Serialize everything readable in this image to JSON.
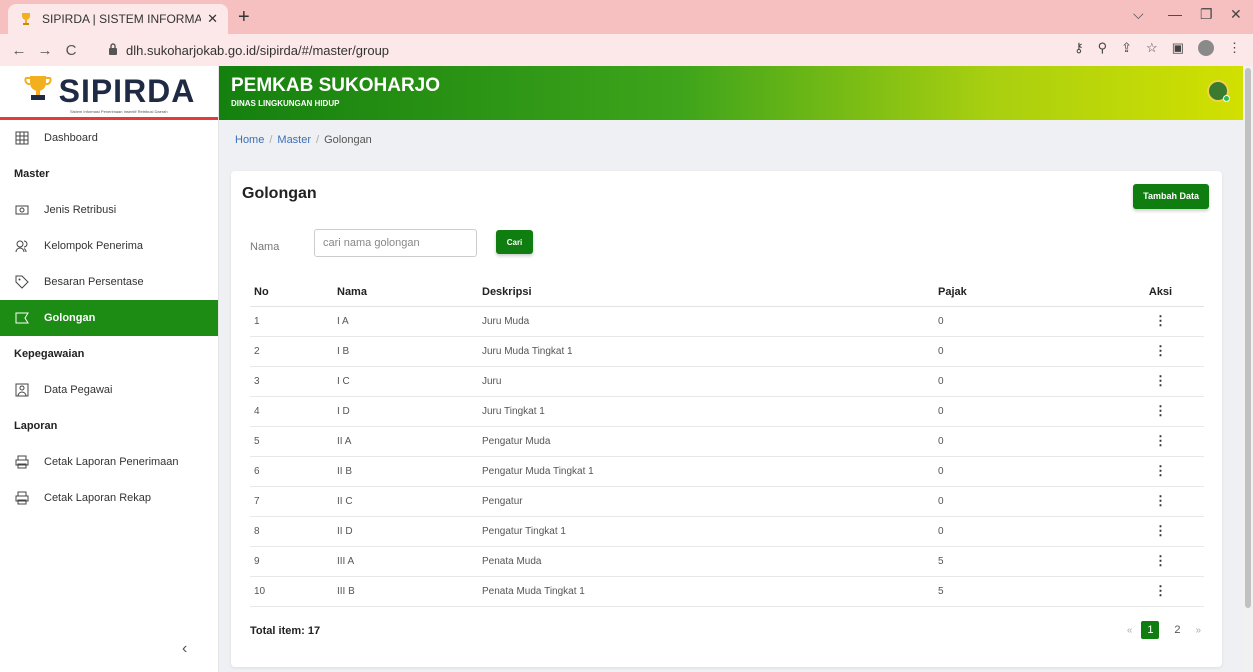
{
  "browser": {
    "tab_title": "SIPIRDA | SISTEM INFORMASI PE",
    "new_tab": "+",
    "url": "dlh.sukoharjokab.go.id/sipirda/#/master/group",
    "back": "←",
    "forward": "→",
    "reload": "C",
    "minimize": "—",
    "restore": "❐",
    "close": "✕",
    "dropdown": "⌵"
  },
  "sidebar": {
    "brand": "SIPIRDA",
    "brand_sub": "Sistem Informasi Penerimaan Insentif Retribusi Daerah",
    "dashboard": "Dashboard",
    "section_master": "Master",
    "jenis_retribusi": "Jenis Retribusi",
    "kelompok_penerima": "Kelompok Penerima",
    "besaran_persentase": "Besaran Persentase",
    "golongan": "Golongan",
    "section_kepegawaian": "Kepegawaian",
    "data_pegawai": "Data Pegawai",
    "section_laporan": "Laporan",
    "cetak_penerimaan": "Cetak Laporan Penerimaan",
    "cetak_rekap": "Cetak Laporan Rekap",
    "collapse": "‹"
  },
  "header": {
    "title": "PEMKAB SUKOHARJO",
    "subtitle": "DINAS LINGKUNGAN HIDUP"
  },
  "breadcrumb": {
    "home": "Home",
    "master": "Master",
    "current": "Golongan",
    "sep": "/"
  },
  "card": {
    "title": "Golongan",
    "add_button": "Tambah Data",
    "filter_label": "Nama",
    "filter_placeholder": "cari nama golongan",
    "search_button": "Cari"
  },
  "table": {
    "headers": {
      "no": "No",
      "nama": "Nama",
      "deskripsi": "Deskripsi",
      "pajak": "Pajak",
      "aksi": "Aksi"
    },
    "rows": [
      {
        "no": "1",
        "nama": "I A",
        "deskripsi": "Juru Muda",
        "pajak": "0",
        "aksi": "⋮"
      },
      {
        "no": "2",
        "nama": "I B",
        "deskripsi": "Juru Muda Tingkat 1",
        "pajak": "0",
        "aksi": "⋮"
      },
      {
        "no": "3",
        "nama": "I C",
        "deskripsi": "Juru",
        "pajak": "0",
        "aksi": "⋮"
      },
      {
        "no": "4",
        "nama": "I D",
        "deskripsi": "Juru Tingkat 1",
        "pajak": "0",
        "aksi": "⋮"
      },
      {
        "no": "5",
        "nama": "II A",
        "deskripsi": "Pengatur Muda",
        "pajak": "0",
        "aksi": "⋮"
      },
      {
        "no": "6",
        "nama": "II B",
        "deskripsi": "Pengatur Muda Tingkat 1",
        "pajak": "0",
        "aksi": "⋮"
      },
      {
        "no": "7",
        "nama": "II C",
        "deskripsi": "Pengatur",
        "pajak": "0",
        "aksi": "⋮"
      },
      {
        "no": "8",
        "nama": "II D",
        "deskripsi": "Pengatur Tingkat 1",
        "pajak": "0",
        "aksi": "⋮"
      },
      {
        "no": "9",
        "nama": "III A",
        "deskripsi": "Penata Muda",
        "pajak": "5",
        "aksi": "⋮"
      },
      {
        "no": "10",
        "nama": "III B",
        "deskripsi": "Penata Muda Tingkat 1",
        "pajak": "5",
        "aksi": "⋮"
      }
    ]
  },
  "footer": {
    "total": "Total item: 17",
    "prev": "«",
    "next": "»",
    "pages": [
      "1",
      "2"
    ]
  },
  "colors": {
    "accent_green": "#0f7d0f",
    "header_gradient_start": "#14800e",
    "header_gradient_end": "#d2e000",
    "logo_underline": "#e23b3b"
  }
}
